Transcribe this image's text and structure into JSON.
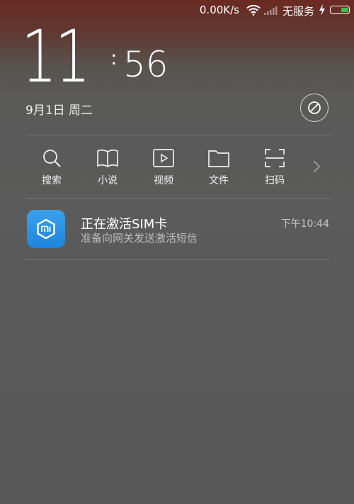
{
  "status_bar": {
    "speed": "0.00K/s",
    "service": "无服务",
    "icons": [
      "wifi-icon",
      "signal-icon",
      "bolt-icon",
      "battery-icon"
    ],
    "battery_color": "#36c24a"
  },
  "clock": {
    "hour": "11",
    "colon": ":",
    "minute": "56",
    "date": "9月1日 周二"
  },
  "shortcuts": [
    {
      "icon": "search-icon",
      "label": "搜索"
    },
    {
      "icon": "book-icon",
      "label": "小说"
    },
    {
      "icon": "video-icon",
      "label": "视频"
    },
    {
      "icon": "folder-icon",
      "label": "文件"
    },
    {
      "icon": "scan-icon",
      "label": "扫码"
    }
  ],
  "notification": {
    "app_icon": "mi-icon",
    "title": "正在激活SIM卡",
    "body": "准备向网关发送激活短信",
    "time": "下午10:44",
    "icon_color": "#2a92e6"
  }
}
